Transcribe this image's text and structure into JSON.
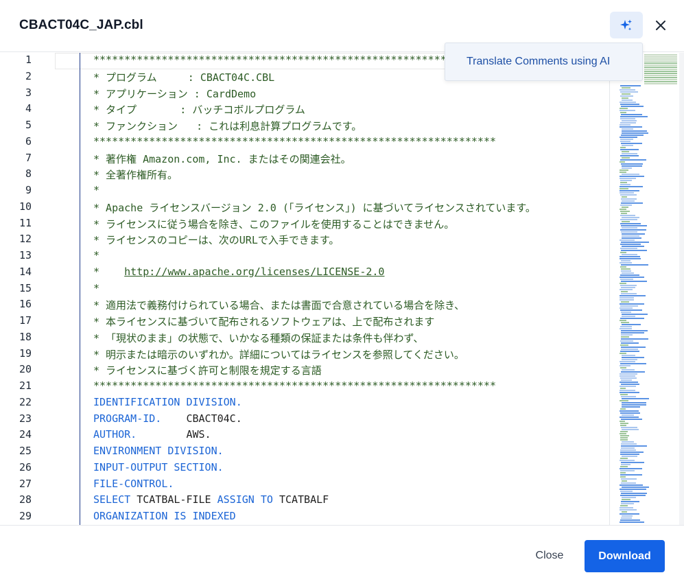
{
  "dialog": {
    "title": "CBACT04C_JAP.cbl",
    "ai_button_icon": "sparkles-icon",
    "close_icon": "close-icon",
    "ai_menu": {
      "translate_label": "Translate Comments using AI"
    }
  },
  "editor": {
    "lines": [
      {
        "n": "1",
        "parts": [
          {
            "t": "************************************************************",
            "c": "cm"
          }
        ]
      },
      {
        "n": "2",
        "parts": [
          {
            "t": "* プログラム     : CBACT04C.CBL",
            "c": "cm"
          }
        ]
      },
      {
        "n": "3",
        "parts": [
          {
            "t": "* アプリケーション : CardDemo",
            "c": "cm"
          }
        ]
      },
      {
        "n": "4",
        "parts": [
          {
            "t": "* タイプ       : バッチコボルプログラム",
            "c": "cm"
          }
        ]
      },
      {
        "n": "5",
        "parts": [
          {
            "t": "* ファンクション   : これは利息計算プログラムです。",
            "c": "cm"
          }
        ]
      },
      {
        "n": "6",
        "parts": [
          {
            "t": "*****************************************************************",
            "c": "cm"
          }
        ]
      },
      {
        "n": "7",
        "parts": [
          {
            "t": "* 著作権 Amazon.com, Inc. またはその関連会社。",
            "c": "cm"
          }
        ]
      },
      {
        "n": "8",
        "parts": [
          {
            "t": "* 全著作権所有。",
            "c": "cm"
          }
        ]
      },
      {
        "n": "9",
        "parts": [
          {
            "t": "*",
            "c": "cm"
          }
        ]
      },
      {
        "n": "10",
        "parts": [
          {
            "t": "* Apache ライセンスバージョン 2.0 (「ライセンス」) に基づいてライセンスされています。",
            "c": "cm"
          }
        ]
      },
      {
        "n": "11",
        "parts": [
          {
            "t": "* ライセンスに従う場合を除き、このファイルを使用することはできません。",
            "c": "cm"
          }
        ]
      },
      {
        "n": "12",
        "parts": [
          {
            "t": "* ライセンスのコピーは、次のURLで入手できます。",
            "c": "cm"
          }
        ]
      },
      {
        "n": "13",
        "parts": [
          {
            "t": "*",
            "c": "cm"
          }
        ]
      },
      {
        "n": "14",
        "parts": [
          {
            "t": "*    ",
            "c": "cm"
          },
          {
            "t": "http://www.apache.org/licenses/LICENSE-2.0",
            "c": "url"
          }
        ]
      },
      {
        "n": "15",
        "parts": [
          {
            "t": "*",
            "c": "cm"
          }
        ]
      },
      {
        "n": "16",
        "parts": [
          {
            "t": "* 適用法で義務付けられている場合、または書面で合意されている場合を除き、",
            "c": "cm"
          }
        ]
      },
      {
        "n": "17",
        "parts": [
          {
            "t": "* 本ライセンスに基づいて配布されるソフトウェアは、上で配布されます",
            "c": "cm"
          }
        ]
      },
      {
        "n": "18",
        "parts": [
          {
            "t": "* 「現状のまま」の状態で、いかなる種類の保証または条件も伴わず、",
            "c": "cm"
          }
        ]
      },
      {
        "n": "19",
        "parts": [
          {
            "t": "* 明示または暗示のいずれか。詳細についてはライセンスを参照してください。",
            "c": "cm"
          }
        ]
      },
      {
        "n": "20",
        "parts": [
          {
            "t": "* ライセンスに基づく許可と制限を規定する言語",
            "c": "cm"
          }
        ]
      },
      {
        "n": "21",
        "parts": [
          {
            "t": "*****************************************************************",
            "c": "cm"
          }
        ]
      },
      {
        "n": "22",
        "parts": [
          {
            "t": "IDENTIFICATION DIVISION.",
            "c": "kw"
          }
        ]
      },
      {
        "n": "23",
        "parts": [
          {
            "t": "PROGRAM-ID.    ",
            "c": "kw"
          },
          {
            "t": "CBACT04C.",
            "c": ""
          }
        ]
      },
      {
        "n": "24",
        "parts": [
          {
            "t": "AUTHOR.        ",
            "c": "kw"
          },
          {
            "t": "AWS.",
            "c": ""
          }
        ]
      },
      {
        "n": "25",
        "parts": [
          {
            "t": "ENVIRONMENT DIVISION.",
            "c": "kw"
          }
        ]
      },
      {
        "n": "26",
        "parts": [
          {
            "t": "INPUT-OUTPUT SECTION.",
            "c": "kw"
          }
        ]
      },
      {
        "n": "27",
        "parts": [
          {
            "t": "FILE-CONTROL.",
            "c": "kw"
          }
        ]
      },
      {
        "n": "28",
        "parts": [
          {
            "t": "SELECT ",
            "c": "kw"
          },
          {
            "t": "TCATBAL-FILE ",
            "c": ""
          },
          {
            "t": "ASSIGN TO ",
            "c": "kw"
          },
          {
            "t": "TCATBALF",
            "c": ""
          }
        ]
      },
      {
        "n": "29",
        "parts": [
          {
            "t": "ORGANIZATION IS INDEXED",
            "c": "kw"
          }
        ]
      }
    ]
  },
  "colors": {
    "keyword": "#1c65d6",
    "comment": "#2c5b24",
    "primary": "#1463e6"
  },
  "footer": {
    "close_label": "Close",
    "download_label": "Download"
  }
}
